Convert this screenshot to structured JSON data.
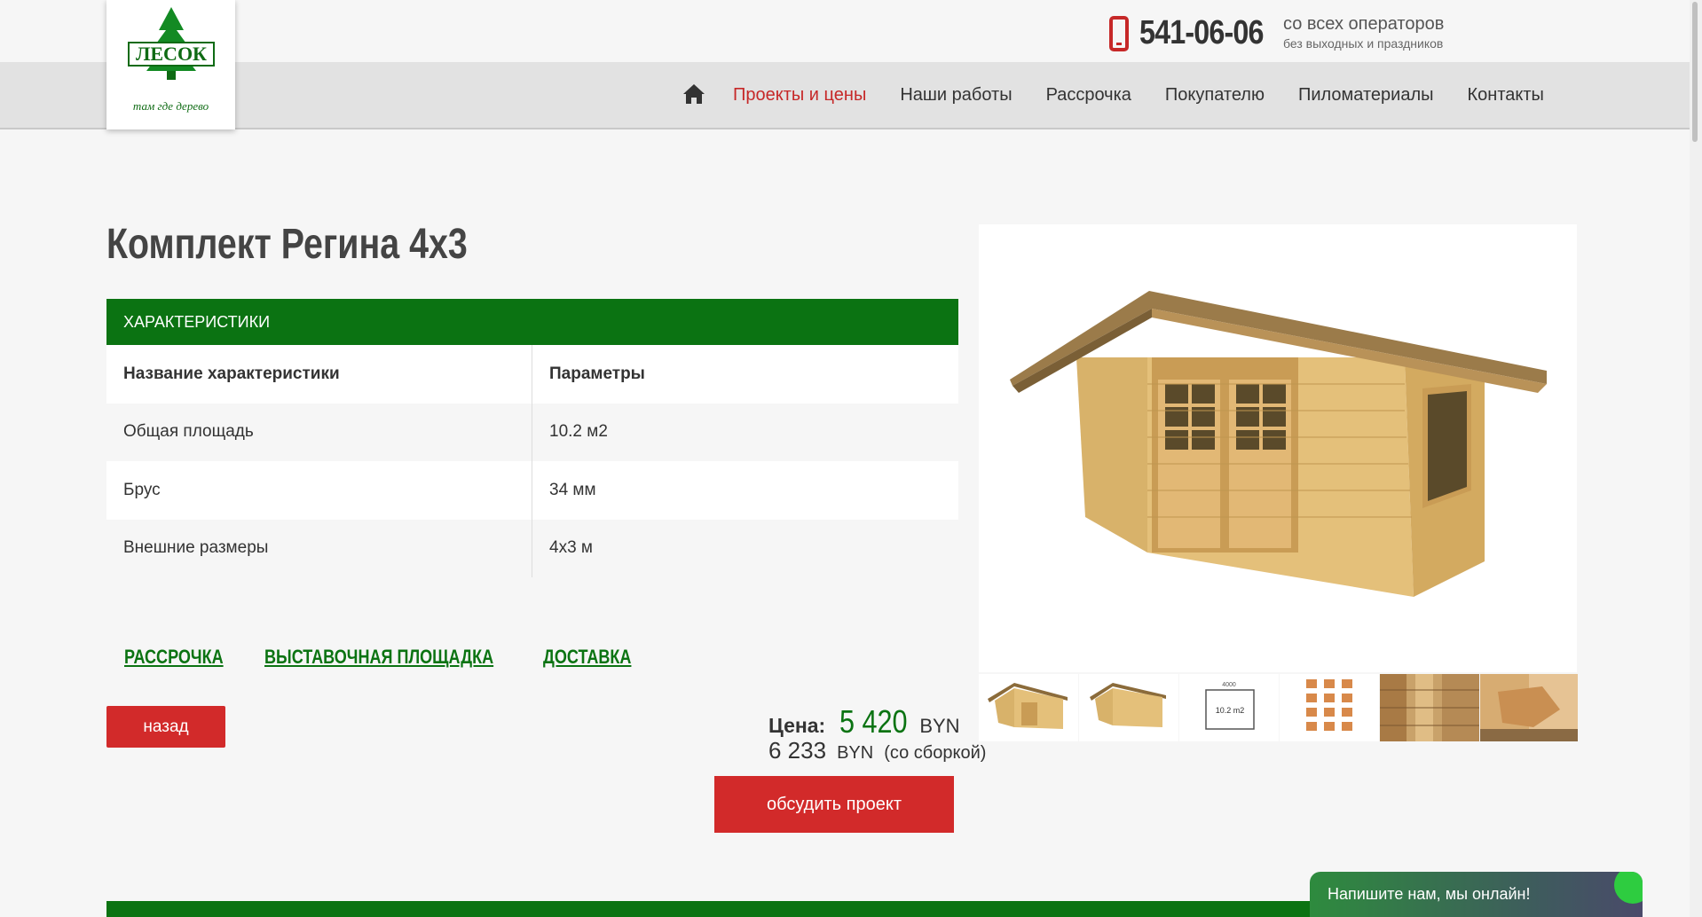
{
  "header": {
    "logo": {
      "brand": "ЛЕСОК",
      "tagline": "там где дерево"
    },
    "phone": {
      "number": "541-06-06",
      "line1": "со всех операторов",
      "line2": "без выходных и праздников"
    },
    "nav": [
      {
        "label": "Проекты и цены",
        "active": true
      },
      {
        "label": "Наши работы",
        "active": false
      },
      {
        "label": "Рассрочка",
        "active": false
      },
      {
        "label": "Покупателю",
        "active": false
      },
      {
        "label": "Пиломатериалы",
        "active": false
      },
      {
        "label": "Контакты",
        "active": false
      }
    ]
  },
  "product": {
    "title": "Комплект Регина 4х3",
    "specs_heading": "ХАРАКТЕРИСТИКИ",
    "specs_columns": [
      "Название характеристики",
      "Параметры"
    ],
    "specs": [
      [
        "Общая площадь",
        "10.2 м2"
      ],
      [
        "Брус",
        "34 мм"
      ],
      [
        "Внешние размеры",
        "4х3 м"
      ]
    ],
    "links": [
      "РАССРОЧКА",
      "ВЫСТАВОЧНАЯ ПЛОЩАДКА",
      "ДОСТАВКА"
    ],
    "back_label": "назад",
    "price": {
      "label": "Цена:",
      "value": "5 420",
      "currency": "BYN",
      "assembled_value": "6 233",
      "assembled_currency": "BYN",
      "assembled_note": "(со сборкой)"
    },
    "discuss_label": "обсудить проект",
    "plan_label": "10.2 m2",
    "plan_dim": "4000"
  },
  "chat": {
    "label": "Напишите нам, мы онлайн!"
  },
  "colors": {
    "green": "#0b7312",
    "red": "#d22a2a",
    "nav_bg": "#e2e2e2"
  }
}
